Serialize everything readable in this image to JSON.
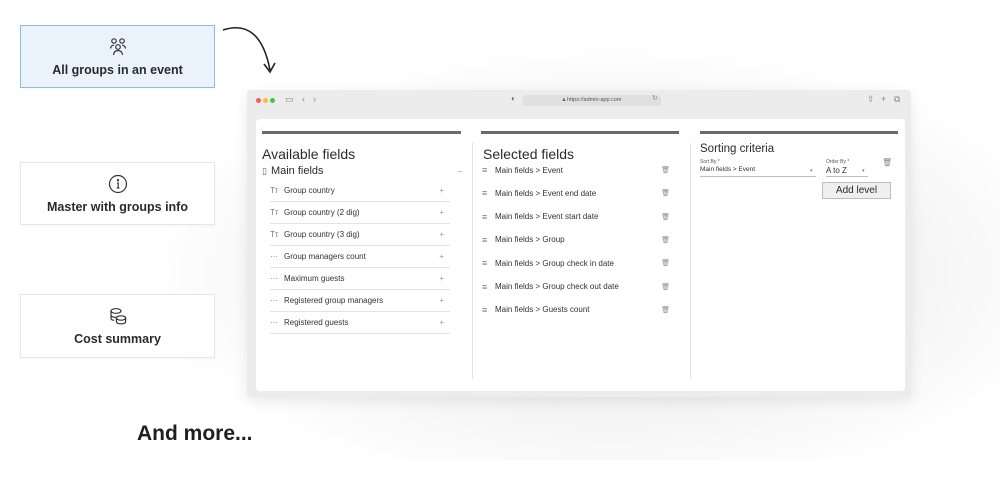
{
  "cards": [
    {
      "label": "All groups in an event",
      "icon": "users-group-icon",
      "active": true
    },
    {
      "label": "Master with groups info",
      "icon": "info-icon",
      "active": false
    },
    {
      "label": "Cost summary",
      "icon": "coins-stack-icon",
      "active": false
    }
  ],
  "footer_text": "And more...",
  "browser": {
    "url": "https://admin-app.com"
  },
  "available": {
    "title": "Available fields",
    "group_label": "Main fields",
    "items": [
      {
        "label": "Group country",
        "icon": "text-type-icon",
        "glyph": "Tт"
      },
      {
        "label": "Group country (2 dig)",
        "icon": "text-type-icon",
        "glyph": "Tт"
      },
      {
        "label": "Group country (3 dig)",
        "icon": "text-type-icon",
        "glyph": "Tт"
      },
      {
        "label": "Group managers count",
        "icon": "number-type-icon",
        "glyph": "···"
      },
      {
        "label": "Maximum guests",
        "icon": "number-type-icon",
        "glyph": "···"
      },
      {
        "label": "Registered group managers",
        "icon": "number-type-icon",
        "glyph": "···"
      },
      {
        "label": "Registered guests",
        "icon": "number-type-icon",
        "glyph": "···"
      }
    ]
  },
  "selected": {
    "title": "Selected fields",
    "items": [
      "Main fields > Event",
      "Main fields > Event end date",
      "Main fields > Event start date",
      "Main fields > Group",
      "Main fields > Group check in date",
      "Main fields > Group check out date",
      "Main fields > Guests count"
    ]
  },
  "sorting": {
    "title": "Sorting criteria",
    "sort_by_label": "Sort By *",
    "sort_by_value": "Main fields > Event",
    "order_by_label": "Order By *",
    "order_by_value": "A to Z",
    "add_level_label": "Add level"
  }
}
